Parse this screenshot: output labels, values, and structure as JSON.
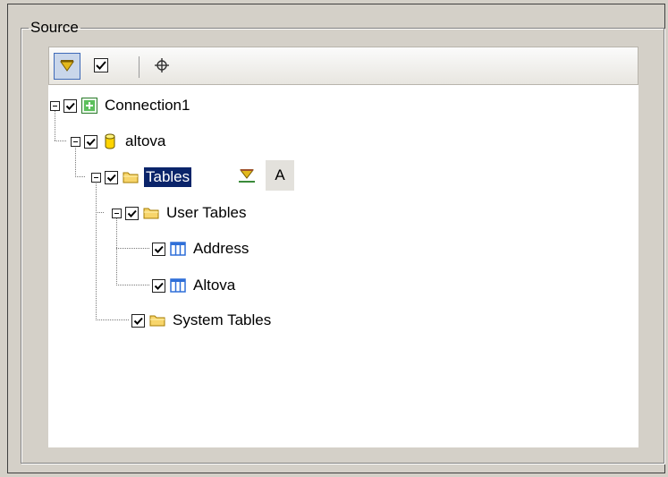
{
  "group": {
    "legend": "Source"
  },
  "toolbar": {
    "filter_button": "filter-icon",
    "check_button": "check-icon",
    "locate_button": "crosshair-icon"
  },
  "tree": {
    "connection": {
      "label": "Connection1",
      "checked": true,
      "expanded": true
    },
    "database": {
      "label": "altova",
      "checked": true,
      "expanded": true
    },
    "tables": {
      "label": "Tables",
      "checked": true,
      "expanded": true,
      "selected": true,
      "filter_icon": "small-filter-icon",
      "alias_label": "A"
    },
    "user_tables": {
      "label": "User Tables",
      "checked": true,
      "expanded": true
    },
    "address": {
      "label": "Address",
      "checked": true
    },
    "altova_table": {
      "label": "Altova",
      "checked": true
    },
    "system_tables": {
      "label": "System Tables",
      "checked": true
    }
  },
  "colors": {
    "selection": "#0a246a",
    "folder": "#f3cf63",
    "table_icon": "#2f6fd8",
    "connection_icon": "#3c9a3c"
  }
}
